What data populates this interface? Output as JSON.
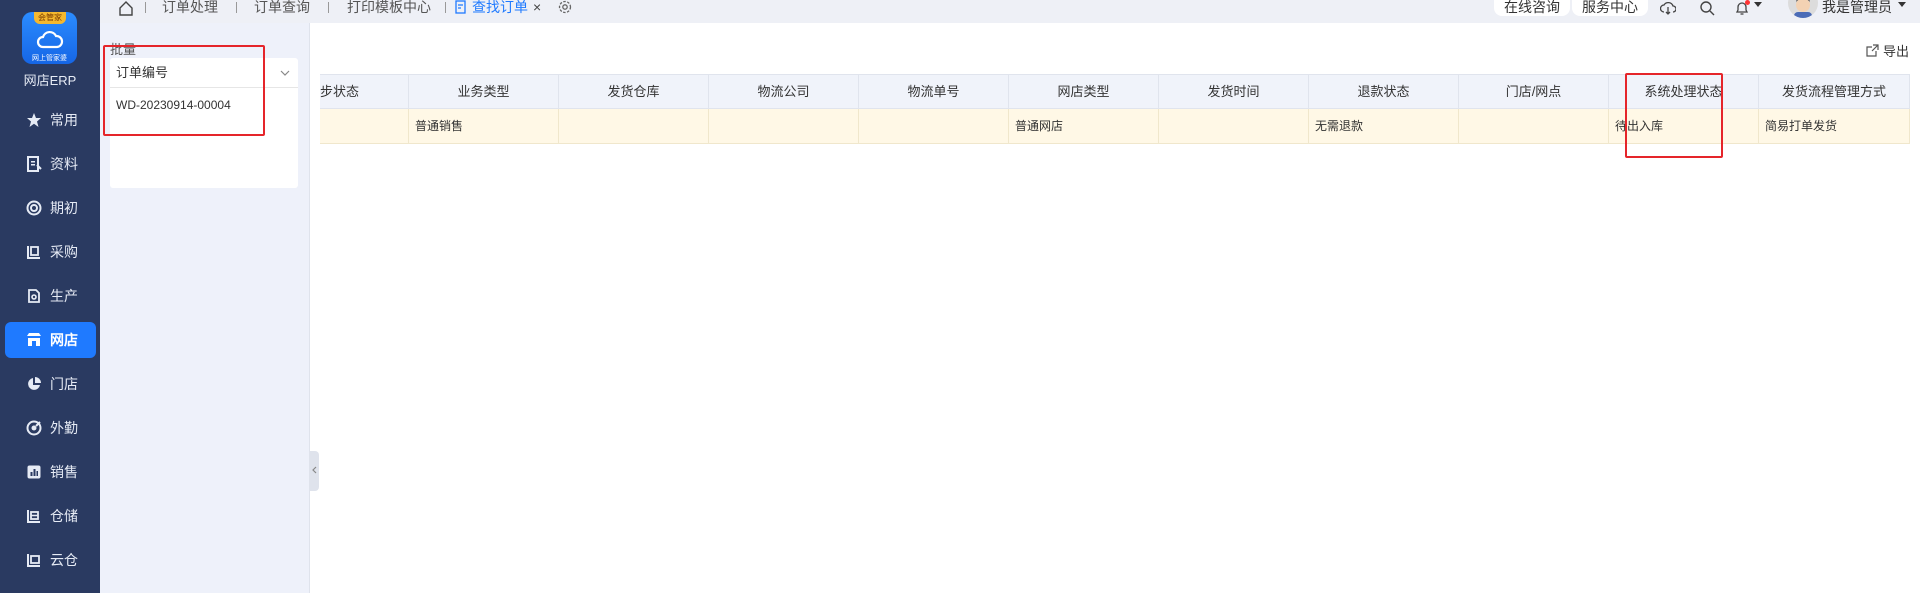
{
  "app": {
    "logo_badge": "会管家",
    "logo_text": "网上管家婆",
    "name": "网店ERP"
  },
  "nav": {
    "items": [
      {
        "label": "常用",
        "icon": "star-icon"
      },
      {
        "label": "资料",
        "icon": "document-icon"
      },
      {
        "label": "期初",
        "icon": "target-icon"
      },
      {
        "label": "采购",
        "icon": "purchase-icon"
      },
      {
        "label": "生产",
        "icon": "production-icon"
      },
      {
        "label": "网店",
        "icon": "store-icon",
        "active": true
      },
      {
        "label": "门店",
        "icon": "pie-icon"
      },
      {
        "label": "外勤",
        "icon": "field-icon"
      },
      {
        "label": "销售",
        "icon": "sales-icon"
      },
      {
        "label": "仓储",
        "icon": "warehouse-icon"
      },
      {
        "label": "云仓",
        "icon": "cloud-warehouse-icon"
      }
    ]
  },
  "topbar": {
    "tabs": [
      {
        "label": "订单处理"
      },
      {
        "label": "订单查询"
      },
      {
        "label": "打印模板中心"
      },
      {
        "label": "查找订单",
        "active": true
      }
    ],
    "online_consult": "在线咨询",
    "service_center": "服务中心",
    "user_name": "我是管理员"
  },
  "filter": {
    "batch_label": "批量",
    "field_select": "订单编号",
    "input_value": "WD-20230914-00004"
  },
  "toolbar": {
    "export_label": "导出"
  },
  "table": {
    "columns": [
      "步状态",
      "业务类型",
      "发货仓库",
      "物流公司",
      "物流单号",
      "网店类型",
      "发货时间",
      "退款状态",
      "门店/网点",
      "系统处理状态",
      "发货流程管理方式"
    ],
    "rows": [
      [
        "",
        "普通销售",
        "",
        "",
        "",
        "普通网店",
        "",
        "无需退款",
        "",
        "待出入库",
        "简易打单发货"
      ]
    ]
  },
  "colors": {
    "nav_bg": "#2a3a61",
    "accent": "#1f7aff",
    "highlight_row": "#fff8e6",
    "annotation_red": "#e5252a"
  }
}
